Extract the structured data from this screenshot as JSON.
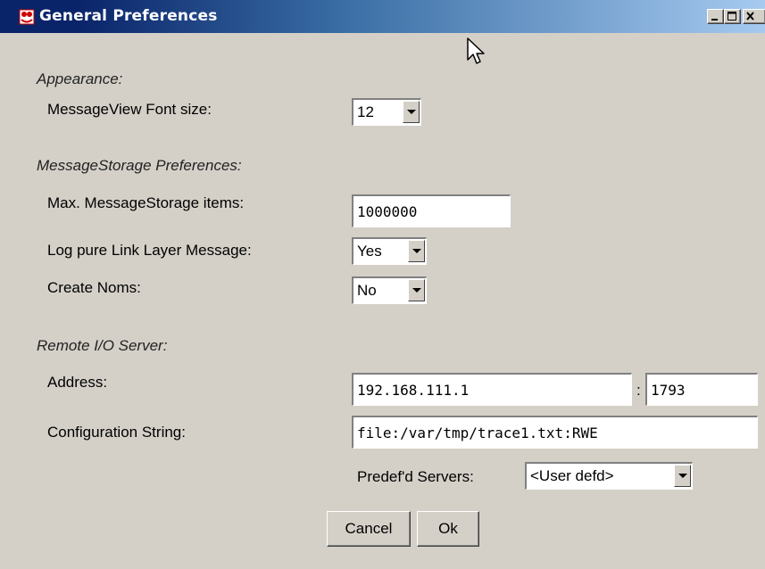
{
  "window": {
    "title": "General Preferences"
  },
  "titlebar_buttons": {
    "minimize": "_",
    "maximize": "□",
    "close": "X"
  },
  "appearance": {
    "heading": "Appearance:",
    "font_size_label": "MessageView Font size:",
    "font_size_value": "12"
  },
  "storage": {
    "heading": "MessageStorage Preferences:",
    "max_items_label": "Max. MessageStorage items:",
    "max_items_value": "1000000",
    "log_link_layer_label": "Log pure Link Layer Message:",
    "log_link_layer_value": "Yes",
    "create_noms_label": "Create Noms:",
    "create_noms_value": "No"
  },
  "remote": {
    "heading": "Remote I/O Server:",
    "address_label": "Address:",
    "address_value": "192.168.111.1",
    "port_separator": ":",
    "port_value": "1793",
    "config_label": "Configuration String:",
    "config_value": "file:/var/tmp/trace1.txt:RWE",
    "predef_label": "Predef'd Servers:",
    "predef_value": "<User defd>"
  },
  "buttons": {
    "cancel": "Cancel",
    "ok": "Ok"
  },
  "colors": {
    "title_active": "#0a246a",
    "face": "#d4d0c8"
  }
}
